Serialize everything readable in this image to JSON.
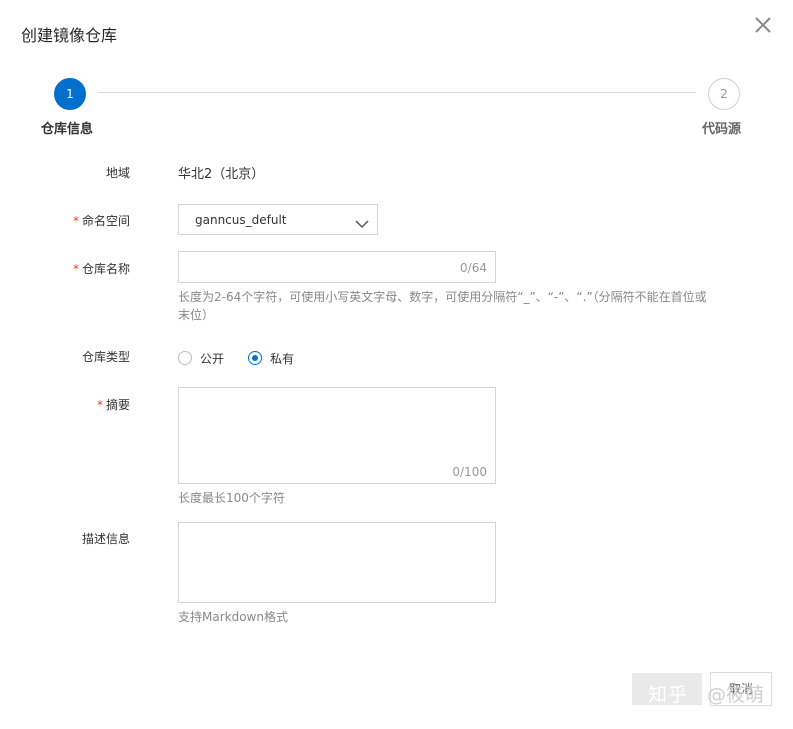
{
  "dialog": {
    "title": "创建镜像仓库"
  },
  "steps": [
    {
      "number": "1",
      "label": "仓库信息"
    },
    {
      "number": "2",
      "label": "代码源"
    }
  ],
  "form": {
    "region": {
      "label": "地域",
      "value": "华北2（北京）"
    },
    "namespace": {
      "label": "命名空间",
      "required_mark": "*",
      "value": "ganncus_defult"
    },
    "repo_name": {
      "label": "仓库名称",
      "required_mark": "*",
      "value": "",
      "counter": "0/64",
      "help_line1": "长度为2-64个字符，可使用小写英文字母、数字，可使用分隔符“_”、“-”、“.”（分隔符不能在首位或",
      "help_line2": "末位）"
    },
    "repo_type": {
      "label": "仓库类型",
      "options": [
        "公开",
        "私有"
      ],
      "selected": "私有"
    },
    "summary": {
      "label": "摘要",
      "required_mark": "*",
      "value": "",
      "counter": "0/100",
      "help": "长度最长100个字符"
    },
    "description": {
      "label": "描述信息",
      "value": "",
      "help": "支持Markdown格式"
    }
  },
  "footer": {
    "cancel_label": "取消"
  },
  "watermark": {
    "text": "知乎",
    "handle": "@筱萌"
  },
  "colors": {
    "primary": "#0070cc",
    "required": "#e5403a"
  }
}
